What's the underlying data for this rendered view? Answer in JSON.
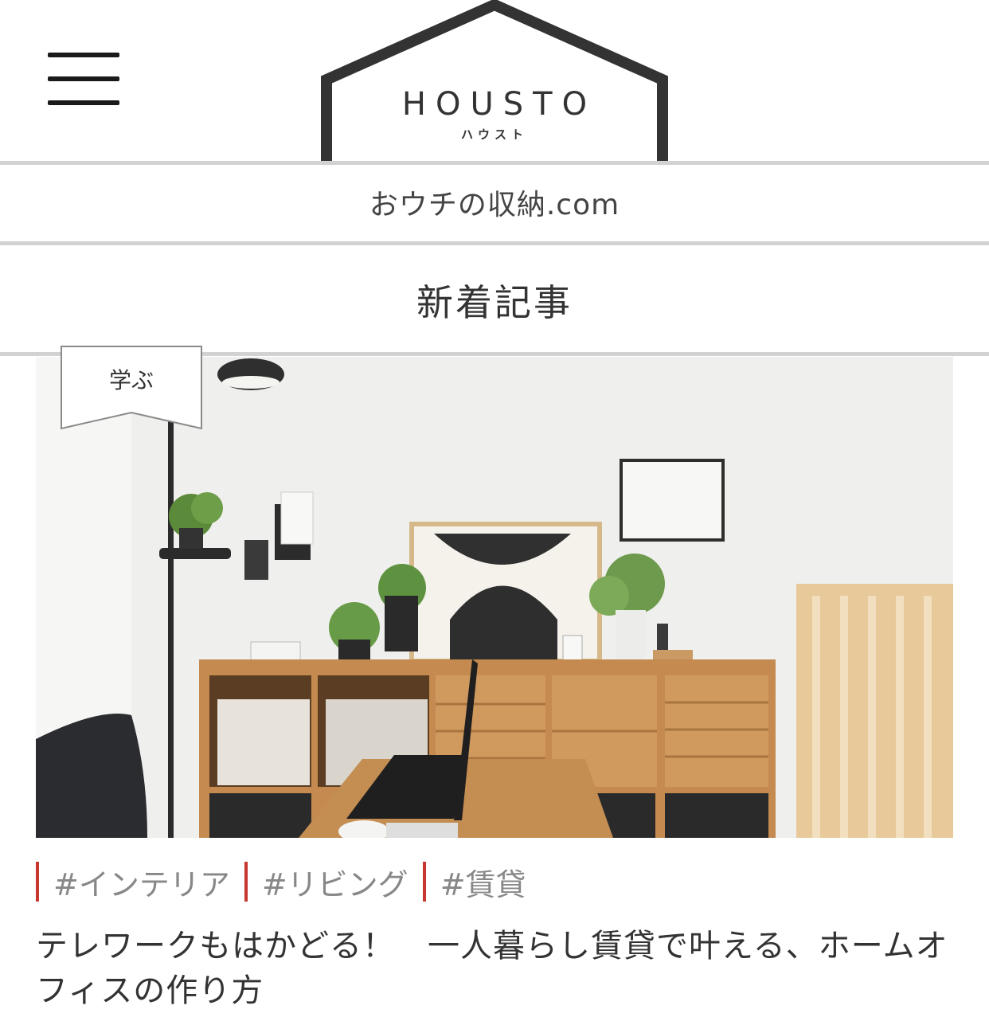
{
  "header": {
    "menu_icon": "hamburger-menu-icon",
    "logo_text": "HOUSTO",
    "logo_sub": "ハウスト"
  },
  "site_name": "おウチの収納.com",
  "section_title": "新着記事",
  "article": {
    "category": "学ぶ",
    "tags": [
      "#インテリア",
      "#リビング",
      "#賃貸"
    ],
    "title": "テレワークもはかどる！　一人暮らし賃貸で叶える、ホームオフィスの作り方"
  },
  "colors": {
    "tag_accent": "#c8372d",
    "rule": "#d2d2d2",
    "logo": "#333333"
  }
}
